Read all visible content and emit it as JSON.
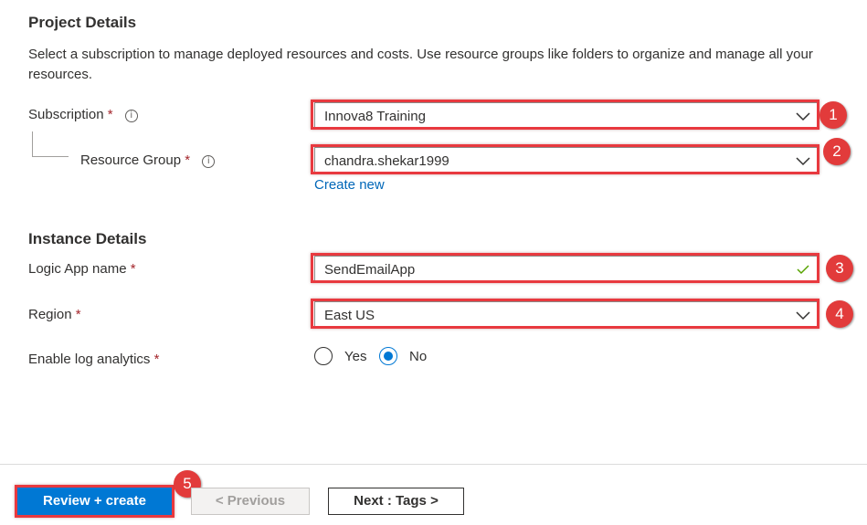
{
  "project": {
    "title": "Project Details",
    "description": "Select a subscription to manage deployed resources and costs. Use resource groups like folders to organize and manage all your resources."
  },
  "subscription": {
    "label": "Subscription",
    "required_mark": "*",
    "value": "Innova8 Training"
  },
  "resource_group": {
    "label": "Resource Group",
    "required_mark": "*",
    "value": "chandra.shekar1999",
    "create_new": "Create new"
  },
  "instance": {
    "title": "Instance Details"
  },
  "logic_app_name": {
    "label": "Logic App name",
    "required_mark": "*",
    "value": "SendEmailApp"
  },
  "region": {
    "label": "Region",
    "required_mark": "*",
    "value": "East US"
  },
  "log_analytics": {
    "label": "Enable log analytics",
    "required_mark": "*",
    "options": [
      "Yes",
      "No"
    ],
    "selected": "No"
  },
  "footer": {
    "review_create": "Review + create",
    "previous": "< Previous",
    "next": "Next : Tags >"
  },
  "callouts": [
    "1",
    "2",
    "3",
    "4",
    "5"
  ],
  "colors": {
    "accent": "#0078d4",
    "callout": "#e23b3b",
    "link": "#0067b8",
    "required": "#a4262c",
    "valid": "#57a300"
  }
}
